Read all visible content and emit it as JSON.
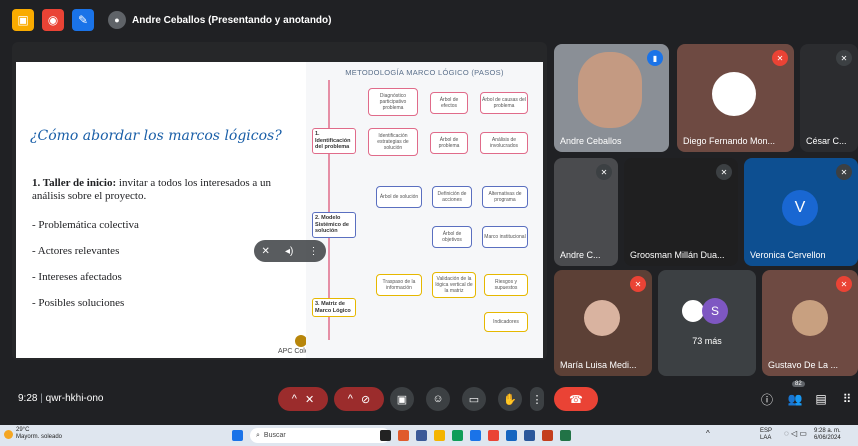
{
  "topbar": {
    "presenter": "Andre Ceballos (Presentando y anotando)"
  },
  "slide": {
    "title": "¿Cómo abordar los marcos lógicos?",
    "lead_bold": "1. Taller de inicio:",
    "lead_rest": " invitar a todos los interesados a un análisis sobre el proyecto.",
    "bullets": [
      "-  Problemática colectiva",
      "-  Actores relevantes",
      "-  Intereses afectados",
      "-  Posibles soluciones"
    ],
    "footer": "APC Colombia",
    "diagram": {
      "title": "METODOLOGÍA MARCO LÓGICO (PASOS)",
      "stage1": "1. Identificación del problema",
      "stage2": "2. Modelo Sistémico de solución",
      "stage3": "3. Matriz de Marco Lógico",
      "b1": "Diagnóstico participativo problema",
      "b2": "Árbol de efectos",
      "b3": "Árbol de causas del problema",
      "b4": "Identificación estrategias de solución",
      "b5": "Árbol de problema",
      "b6": "Análisis de involucrados",
      "b7": "Árbol de solución",
      "b8": "Definición de acciones",
      "b9": "Alternativas de programa",
      "b10": "Árbol de objetivos",
      "b11": "Marco institucional",
      "b12": "Traspaso de la información",
      "b13": "Validación de la lógica vertical de la matriz",
      "b14": "Riesgos y supuestos",
      "b15": "Indicadores"
    }
  },
  "tiles": {
    "andre": "Andre Ceballos",
    "diego": "Diego Fernando Mon...",
    "cesar": "César C...",
    "andre_small": "Andre C...",
    "groosman": "Groosman Millán Dua...",
    "veronica": "Veronica Cervellon",
    "veronica_initial": "V",
    "maria": "María Luisa Medi...",
    "more": "73 más",
    "more_initial": "S",
    "gustavo": "Gustavo De La ..."
  },
  "bottombar": {
    "time": "9:28",
    "meeting_code": "qwr-hkhi-ono",
    "participants_count": "82"
  },
  "taskbar": {
    "temp": "29°C",
    "weather": "Mayorm. soleado",
    "search_placeholder": "Buscar",
    "lang1": "ESP",
    "lang2": "LAA",
    "clock1": "9:28 a. m.",
    "clock2": "6/06/2024"
  }
}
